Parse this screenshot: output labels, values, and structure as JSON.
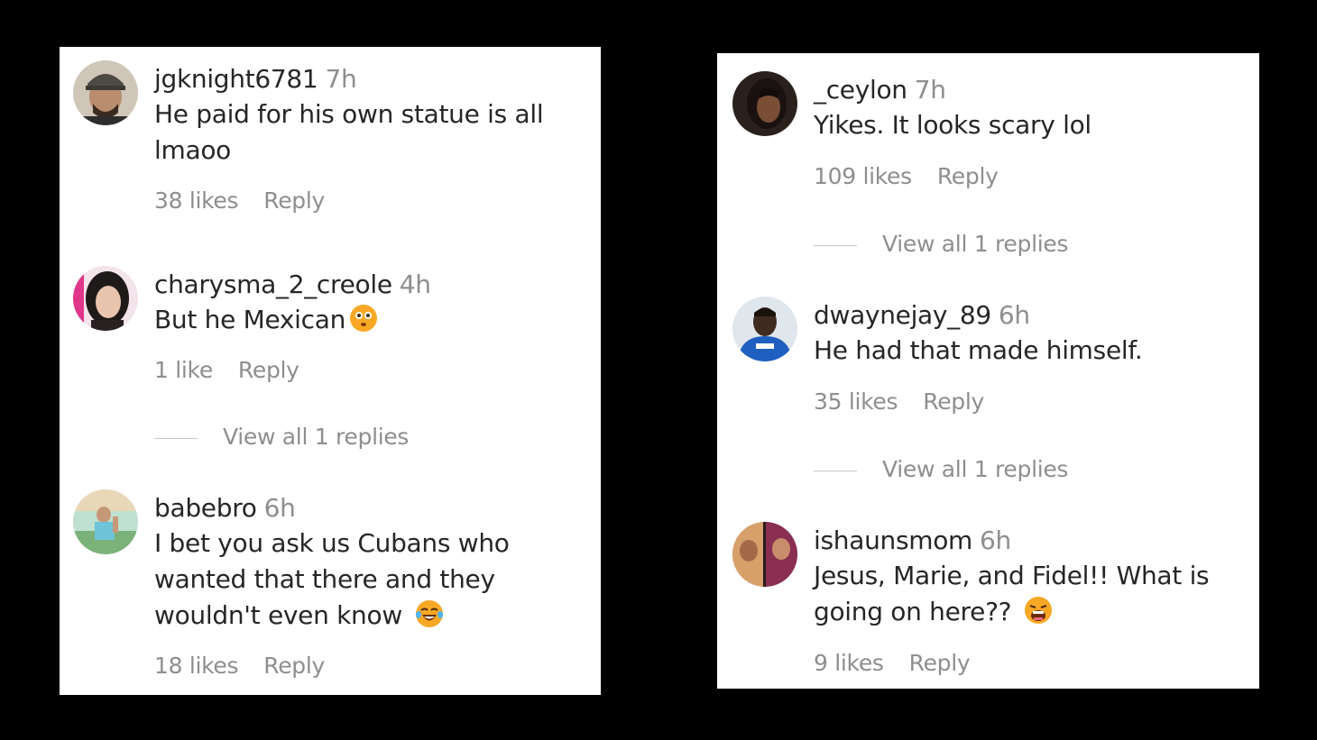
{
  "left_panel": {
    "comments": [
      {
        "username": "jgknight6781",
        "time": "7h",
        "text_lines": [
          "He paid for his own statue is all",
          "lmaoo"
        ],
        "likes": "38 likes",
        "reply": "Reply"
      },
      {
        "username": "charysma_2_creole",
        "time": "4h",
        "text_lines": [
          "But he Mexican"
        ],
        "emoji": "flushed-face-emoji",
        "likes": "1 like",
        "reply": "Reply",
        "view_replies": "View all 1 replies"
      },
      {
        "username": "babebro",
        "time": "6h",
        "text_lines": [
          "I bet you ask us Cubans who",
          "wanted that there and they",
          "wouldn't even know"
        ],
        "emoji": "laughing-tears-emoji",
        "likes": "18 likes",
        "reply": "Reply"
      }
    ]
  },
  "right_panel": {
    "comments": [
      {
        "username": "_ceylon",
        "time": "7h",
        "text_lines": [
          "Yikes. It looks scary lol"
        ],
        "likes": "109 likes",
        "reply": "Reply",
        "view_replies": "View all 1 replies"
      },
      {
        "username": "dwaynejay_89",
        "time": "6h",
        "text_lines": [
          "He had that made himself."
        ],
        "likes": "35 likes",
        "reply": "Reply",
        "view_replies": "View all 1 replies"
      },
      {
        "username": "ishaunsmom",
        "time": "6h",
        "text_lines": [
          "Jesus, Marie, and Fidel!! What is",
          "going on here??"
        ],
        "emoji": "exhausted-face-emoji",
        "likes": "9 likes",
        "reply": "Reply"
      }
    ]
  },
  "colors": {
    "background": "#000000",
    "panel": "#ffffff",
    "primary_text": "#262626",
    "secondary_text": "#8e8e8e",
    "divider_line": "#c7c7c7",
    "emoji_yellow": "#f9a825"
  }
}
